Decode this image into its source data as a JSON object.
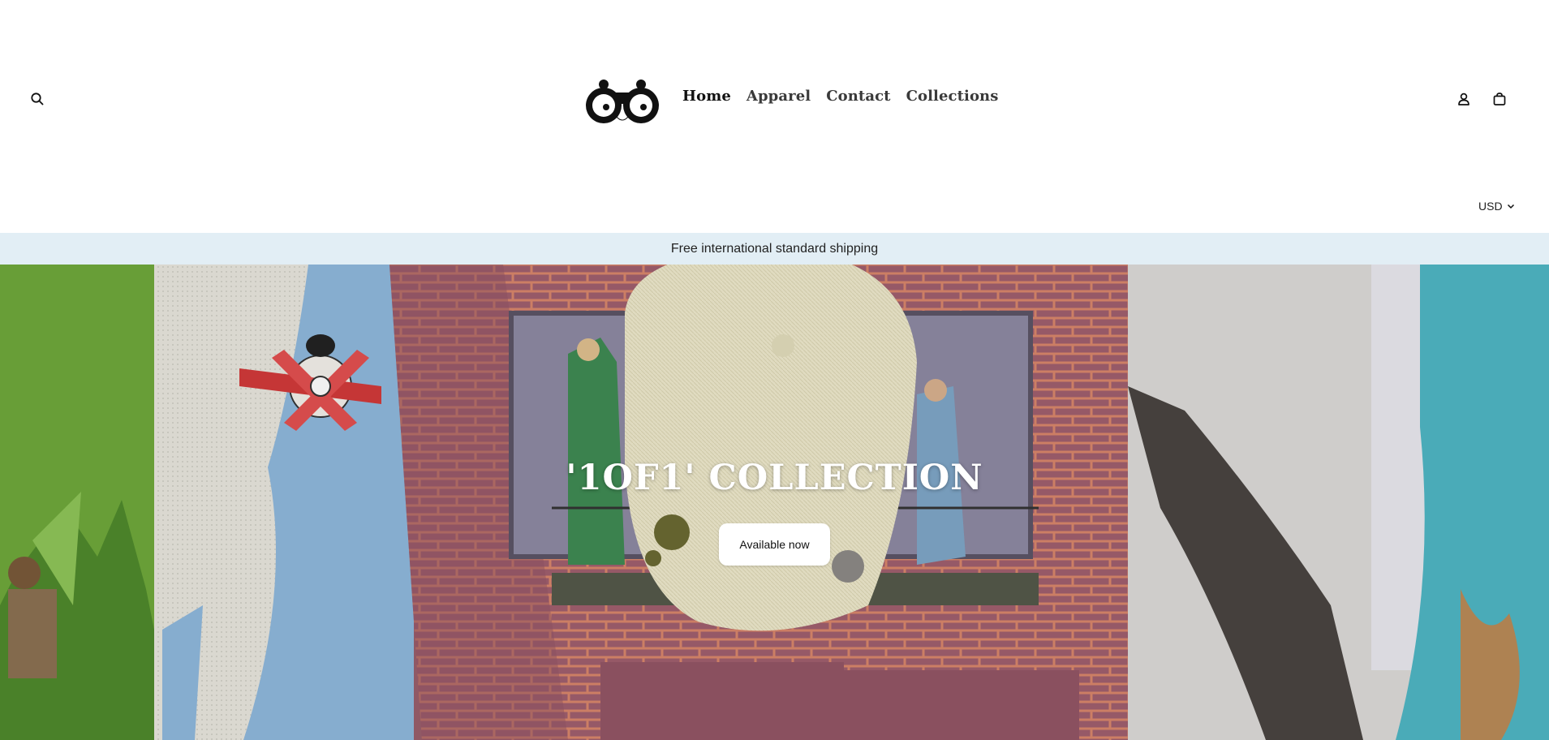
{
  "header": {
    "nav": [
      {
        "label": "Home"
      },
      {
        "label": "Apparel"
      },
      {
        "label": "Contact"
      },
      {
        "label": "Collections"
      }
    ],
    "icons": {
      "search": "search-icon",
      "account": "account-icon",
      "cart": "cart-icon"
    },
    "logo_alt": "binoculars-logo",
    "currency": "USD"
  },
  "announcement": {
    "text": "Free international standard shipping",
    "background": "#e2eef5"
  },
  "hero": {
    "title": "'1OF1' COLLECTION",
    "button_label": "Available now"
  }
}
